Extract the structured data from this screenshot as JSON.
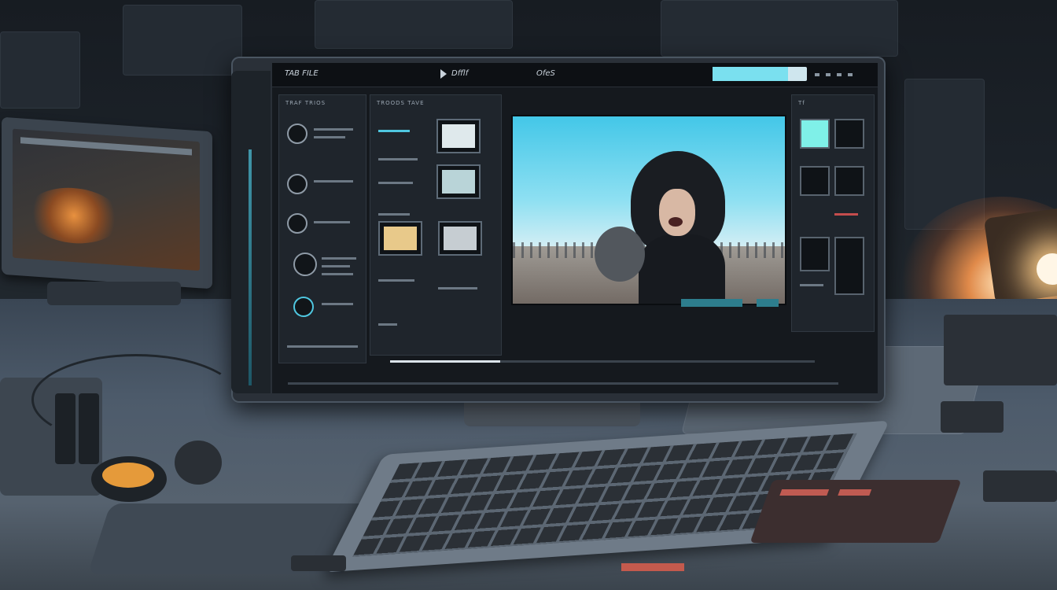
{
  "scene": {
    "description_tags": [
      "workstation",
      "monitor",
      "video-editor",
      "keyboard",
      "desk-lamp"
    ]
  },
  "screen_ui": {
    "top_left_label": "TAB FILE",
    "center_label": "Dfflf",
    "right_label": "OfeS",
    "progress_percent": 80,
    "left_panel_title": "TRAF TRIOS",
    "middle_panel_title": "TROODS TAVE",
    "right_panel_title": "Tf"
  },
  "colors": {
    "accent_cyan": "#4fc7e0",
    "warm_light": "#ffcf8a",
    "screen_bg": "#15191e"
  }
}
